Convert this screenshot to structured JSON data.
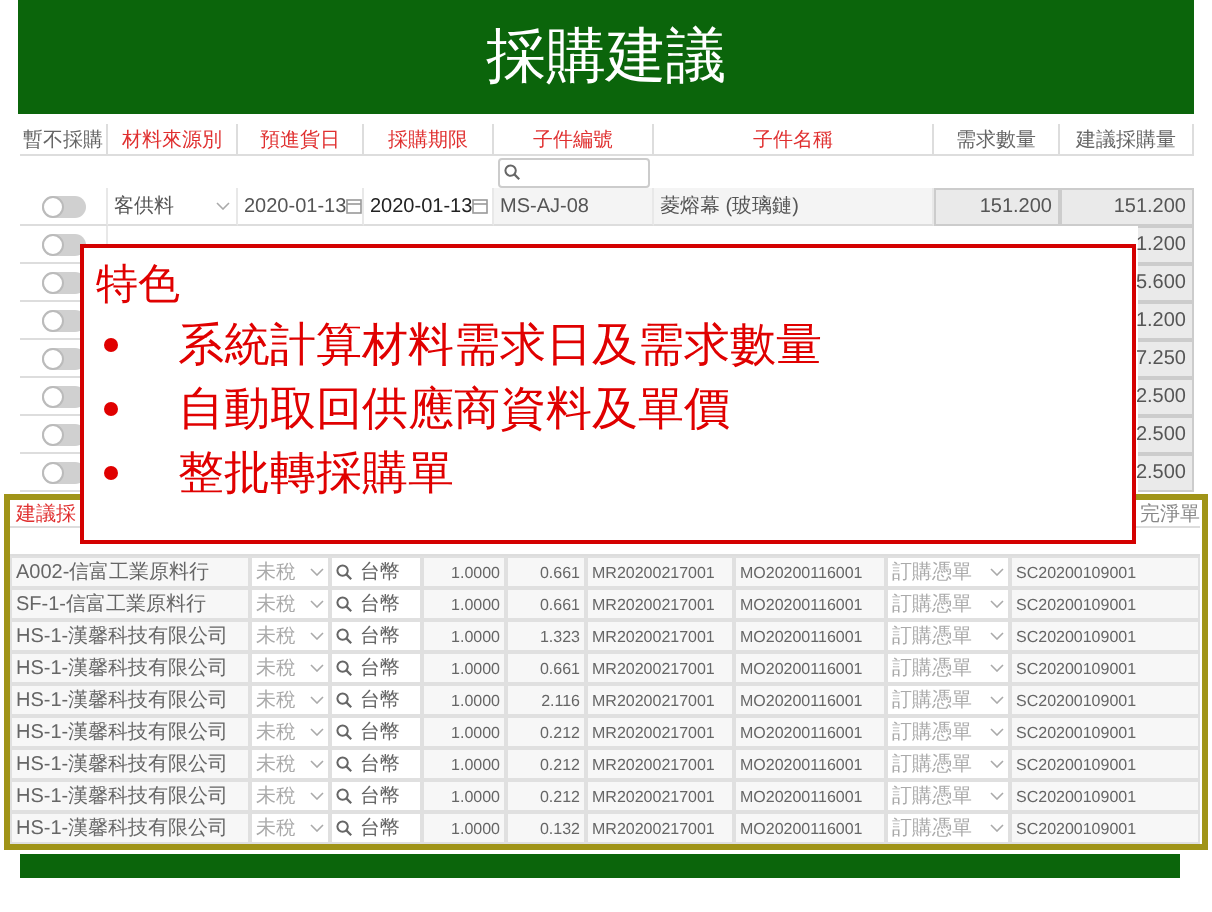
{
  "slide": {
    "title": "採購建議"
  },
  "top_table": {
    "columns": [
      {
        "label": "暫不採購",
        "color": "#666666"
      },
      {
        "label": "材料來源別",
        "color": "#e03030"
      },
      {
        "label": "預進貨日",
        "color": "#e03030"
      },
      {
        "label": "採購期限",
        "color": "#e03030"
      },
      {
        "label": "子件編號",
        "color": "#e03030"
      },
      {
        "label": "子件名稱",
        "color": "#e03030"
      },
      {
        "label": "需求數量",
        "color": "#666666"
      },
      {
        "label": "建議採購量",
        "color": "#666666"
      }
    ],
    "rows": [
      {
        "on": false,
        "source": "客供料",
        "arrival_date": "2020-01-13",
        "deadline": "2020-01-13",
        "part_no": "MS-AJ-08",
        "part_name": "菱熔幕 (玻璃鏈)",
        "demand": "151.200",
        "suggested": "151.200"
      },
      {
        "on": false,
        "suggested": "1.200"
      },
      {
        "on": false,
        "suggested": "5.600"
      },
      {
        "on": false,
        "suggested": "1.200"
      },
      {
        "on": false,
        "suggested": "7.250"
      },
      {
        "on": false,
        "suggested": "2.500"
      },
      {
        "on": false,
        "suggested": "2.500"
      },
      {
        "on": false,
        "suggested": "2.500"
      }
    ]
  },
  "callout": {
    "title": "特色",
    "bullets": [
      "系統計算材料需求日及需求數量",
      "自動取回供應商資料及單價",
      "整批轉採購單"
    ]
  },
  "bottom_table": {
    "header_left": "建議採",
    "header_right": "完淨單",
    "rows": [
      {
        "supplier": "A002-信富工業原料行",
        "tax": "未稅",
        "currency": "台幣",
        "rate": "1.0000",
        "qty": "0.661",
        "mr_no": "MR20200217001",
        "mo_no": "MO20200116001",
        "doc_type": "訂購憑單",
        "sc_no": "SC20200109001"
      },
      {
        "supplier": "SF-1-信富工業原料行",
        "tax": "未稅",
        "currency": "台幣",
        "rate": "1.0000",
        "qty": "0.661",
        "mr_no": "MR20200217001",
        "mo_no": "MO20200116001",
        "doc_type": "訂購憑單",
        "sc_no": "SC20200109001"
      },
      {
        "supplier": "HS-1-漢馨科技有限公司",
        "tax": "未稅",
        "currency": "台幣",
        "rate": "1.0000",
        "qty": "1.323",
        "mr_no": "MR20200217001",
        "mo_no": "MO20200116001",
        "doc_type": "訂購憑單",
        "sc_no": "SC20200109001"
      },
      {
        "supplier": "HS-1-漢馨科技有限公司",
        "tax": "未稅",
        "currency": "台幣",
        "rate": "1.0000",
        "qty": "0.661",
        "mr_no": "MR20200217001",
        "mo_no": "MO20200116001",
        "doc_type": "訂購憑單",
        "sc_no": "SC20200109001"
      },
      {
        "supplier": "HS-1-漢馨科技有限公司",
        "tax": "未稅",
        "currency": "台幣",
        "rate": "1.0000",
        "qty": "2.116",
        "mr_no": "MR20200217001",
        "mo_no": "MO20200116001",
        "doc_type": "訂購憑單",
        "sc_no": "SC20200109001"
      },
      {
        "supplier": "HS-1-漢馨科技有限公司",
        "tax": "未稅",
        "currency": "台幣",
        "rate": "1.0000",
        "qty": "0.212",
        "mr_no": "MR20200217001",
        "mo_no": "MO20200116001",
        "doc_type": "訂購憑單",
        "sc_no": "SC20200109001"
      },
      {
        "supplier": "HS-1-漢馨科技有限公司",
        "tax": "未稅",
        "currency": "台幣",
        "rate": "1.0000",
        "qty": "0.212",
        "mr_no": "MR20200217001",
        "mo_no": "MO20200116001",
        "doc_type": "訂購憑單",
        "sc_no": "SC20200109001"
      },
      {
        "supplier": "HS-1-漢馨科技有限公司",
        "tax": "未稅",
        "currency": "台幣",
        "rate": "1.0000",
        "qty": "0.212",
        "mr_no": "MR20200217001",
        "mo_no": "MO20200116001",
        "doc_type": "訂購憑單",
        "sc_no": "SC20200109001"
      },
      {
        "supplier": "HS-1-漢馨科技有限公司",
        "tax": "未稅",
        "currency": "台幣",
        "rate": "1.0000",
        "qty": "0.132",
        "mr_no": "MR20200217001",
        "mo_no": "MO20200116001",
        "doc_type": "訂購憑單",
        "sc_no": "SC20200109001"
      }
    ]
  }
}
